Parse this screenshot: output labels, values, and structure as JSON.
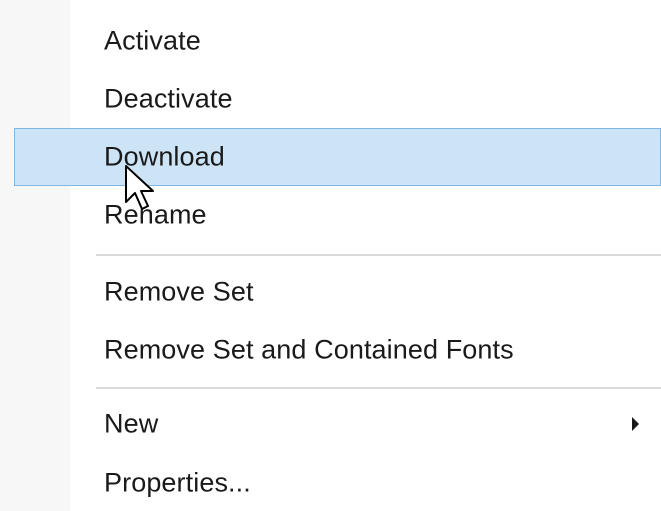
{
  "context_menu": {
    "items": [
      {
        "label": "Activate"
      },
      {
        "label": "Deactivate"
      },
      {
        "label": "Download",
        "state": "highlighted"
      },
      {
        "label": "Rename"
      },
      {
        "label": "Remove Set"
      },
      {
        "label": "Remove Set and Contained Fonts"
      },
      {
        "label": "New",
        "has_submenu": true
      },
      {
        "label": "Properties..."
      }
    ]
  },
  "colors": {
    "highlight_bg": "#cde4f7",
    "highlight_border": "#7fb7e8",
    "separator": "#d9d9d9",
    "gutter": "#f7f7f7"
  },
  "icons": {
    "cursor": "mouse-pointer-icon",
    "submenu": "submenu-arrow-icon"
  }
}
